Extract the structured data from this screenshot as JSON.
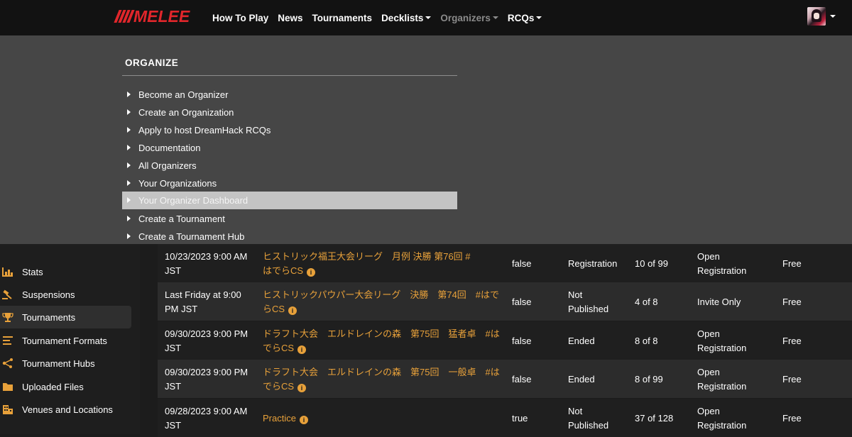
{
  "nav": {
    "logo_text": "MELEE",
    "links": [
      {
        "label": "How To Play",
        "dropdown": false
      },
      {
        "label": "News",
        "dropdown": false
      },
      {
        "label": "Tournaments",
        "dropdown": false
      },
      {
        "label": "Decklists",
        "dropdown": true
      },
      {
        "label": "Organizers",
        "dropdown": true
      },
      {
        "label": "RCQs",
        "dropdown": true
      }
    ]
  },
  "dropdown": {
    "heading": "ORGANIZE",
    "items": [
      "Become an Organizer",
      "Create an Organization",
      "Apply to host DreamHack RCQs",
      "Documentation",
      "All Organizers",
      "Your Organizations",
      "Your Organizer Dashboard",
      "Create a Tournament",
      "Create a Tournament Hub"
    ],
    "highlighted_index": 6
  },
  "sidebar": {
    "items": [
      {
        "label": "Stats",
        "icon": "chart-icon"
      },
      {
        "label": "Suspensions",
        "icon": "gavel-icon"
      },
      {
        "label": "Tournaments",
        "icon": "trophy-icon"
      },
      {
        "label": "Tournament Formats",
        "icon": "list-icon"
      },
      {
        "label": "Tournament Hubs",
        "icon": "hub-icon"
      },
      {
        "label": "Uploaded Files",
        "icon": "folder-icon"
      },
      {
        "label": "Venues and Locations",
        "icon": "building-icon"
      }
    ],
    "active_index": 2
  },
  "table": {
    "rows": [
      {
        "date1": "10/23/2023 9:00 AM",
        "date2": "JST",
        "name1": "ヒストリック福王大会リーグ　月例 決勝 第76回 #",
        "name2": "はでらCS",
        "bool": "false",
        "status1": "",
        "status2": "Registration",
        "players": "10 of 99",
        "reg1": "Open",
        "reg2": "Registration",
        "fee": "Free"
      },
      {
        "date1": "Last Friday at 9:00",
        "date2": "PM JST",
        "name1": "ヒストリックパウパー大会リーグ　決勝　第74回　#はで",
        "name2": "らCS",
        "bool": "false",
        "status1": "Not",
        "status2": "Published",
        "players": "4 of 8",
        "reg1": "Invite Only",
        "reg2": "",
        "fee": "Free"
      },
      {
        "date1": "09/30/2023 9:00 PM",
        "date2": "JST",
        "name1": "ドラフト大会　エルドレインの森　第75回　猛者卓　#は",
        "name2": "でらCS",
        "bool": "false",
        "status1": "Ended",
        "status2": "",
        "players": "8 of 8",
        "reg1": "Open",
        "reg2": "Registration",
        "fee": "Free"
      },
      {
        "date1": "09/30/2023 9:00 PM",
        "date2": "JST",
        "name1": "ドラフト大会　エルドレインの森　第75回　一般卓　#は",
        "name2": "でらCS",
        "bool": "false",
        "status1": "Ended",
        "status2": "",
        "players": "8 of 99",
        "reg1": "Open",
        "reg2": "Registration",
        "fee": "Free"
      },
      {
        "date1": "09/28/2023 9:00 AM",
        "date2": "JST",
        "name1": "Practice",
        "name2": "",
        "bool": "true",
        "status1": "Not",
        "status2": "Published",
        "players": "37 of 128",
        "reg1": "Open",
        "reg2": "Registration",
        "fee": "Free"
      }
    ]
  },
  "colors": {
    "brand": "#e0262b",
    "accent": "#e8a13a",
    "dropdown_bg": "#464646",
    "highlight": "#c4c4c4"
  }
}
